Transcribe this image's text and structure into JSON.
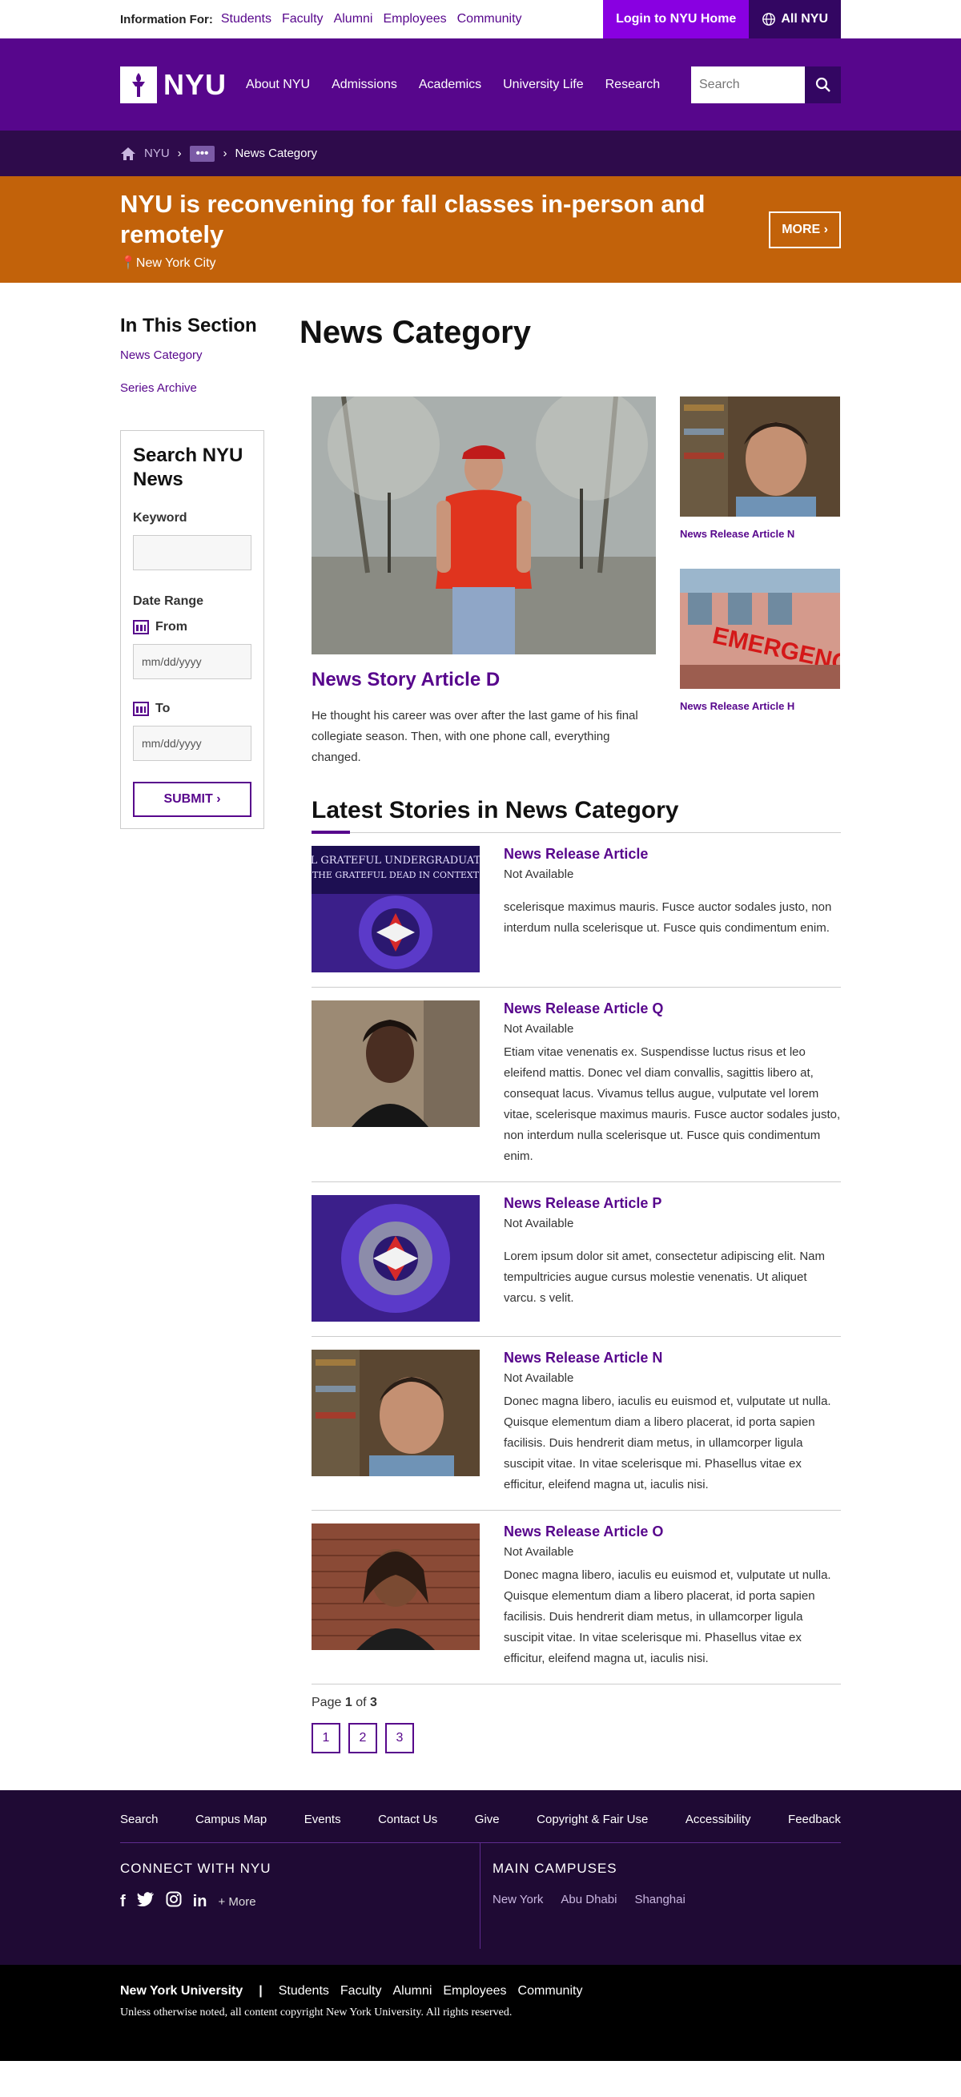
{
  "utility": {
    "label": "Information For:",
    "links": [
      "Students",
      "Faculty",
      "Alumni",
      "Employees",
      "Community"
    ],
    "login": "Login to NYU Home",
    "all_nyu": "All NYU"
  },
  "header": {
    "logo": "NYU",
    "nav": [
      "About NYU",
      "Admissions",
      "Academics",
      "University Life",
      "Research"
    ],
    "search_placeholder": "Search"
  },
  "breadcrumb": {
    "home": "NYU",
    "more": "•••",
    "current": "News Category"
  },
  "alert": {
    "title": "NYU is reconvening for fall classes in-person and remotely",
    "location": "New York City",
    "more": "MORE"
  },
  "sidebar": {
    "title": "In This Section",
    "links": [
      "News Category",
      "Series Archive"
    ],
    "search": {
      "title": "Search NYU News",
      "keyword_label": "Keyword",
      "date_range_label": "Date Range",
      "from_label": "From",
      "from_placeholder": "mm/dd/yyyy",
      "to_label": "To",
      "to_placeholder": "mm/dd/yyyy",
      "submit": "SUBMIT"
    }
  },
  "main": {
    "title": "News Category",
    "featured": {
      "title": "News Story Article D",
      "desc": "He thought his career was over after the last game of his final collegiate season. Then, with one phone call, everything changed."
    },
    "side_cards": [
      {
        "title": "News Release Article N"
      },
      {
        "title": "News Release Article H"
      }
    ],
    "latest_title": "Latest Stories in News Category",
    "stories": [
      {
        "title": "News Release Article",
        "sub": "Not Available",
        "text": "scelerisque maximus mauris. Fusce auctor sodales justo, non interdum nulla scelerisque ut. Fusce quis condimentum enim."
      },
      {
        "title": "News Release Article Q",
        "sub": "Not Available",
        "text": "Etiam vitae venenatis ex. Suspendisse luctus risus et leo eleifend mattis. Donec vel diam convallis, sagittis libero at, consequat lacus. Vivamus tellus augue, vulputate vel lorem vitae, scelerisque maximus mauris. Fusce auctor sodales justo, non interdum nulla scelerisque ut. Fusce quis condimentum enim."
      },
      {
        "title": "News Release Article P",
        "sub": "Not Available",
        "text": "Lorem ipsum dolor sit amet, consectetur adipiscing elit. Nam tempultricies augue cursus molestie venenatis. Ut aliquet varcu. s velit."
      },
      {
        "title": "News Release Article N",
        "sub": "Not Available",
        "text": "Donec magna libero, iaculis eu euismod et, vulputate ut nulla. Quisque elementum diam a libero placerat, id porta sapien facilisis. Duis hendrerit diam metus, in ullamcorper ligula suscipit vitae. In vitae scelerisque mi. Phasellus vitae ex efficitur, eleifend magna ut, iaculis nisi."
      },
      {
        "title": "News Release Article O",
        "sub": "Not Available",
        "text": "Donec magna libero, iaculis eu euismod et, vulputate ut nulla. Quisque elementum diam a libero placerat, id porta sapien facilisis. Duis hendrerit diam metus, in ullamcorper ligula suscipit vitae. In vitae scelerisque mi. Phasellus vitae ex efficitur, eleifend magna ut, iaculis nisi."
      }
    ],
    "pager": {
      "prefix": "Page",
      "current": "1",
      "of": "of",
      "total": "3",
      "pages": [
        "1",
        "2",
        "3"
      ]
    }
  },
  "footer": {
    "links": [
      "Search",
      "Campus Map",
      "Events",
      "Contact Us",
      "Give",
      "Copyright & Fair Use",
      "Accessibility",
      "Feedback"
    ],
    "connect_title": "CONNECT WITH NYU",
    "social": [
      "f",
      "twitter-icon",
      "instagram-icon",
      "in"
    ],
    "social_more": "+ More",
    "campuses_title": "MAIN CAMPUSES",
    "campuses": [
      "New York",
      "Abu Dhabi",
      "Shanghai"
    ]
  },
  "bottom": {
    "brand": "New York University",
    "sep": "|",
    "links": [
      "Students",
      "Faculty",
      "Alumni",
      "Employees",
      "Community"
    ],
    "copyright": "Unless otherwise noted, all content copyright New York University. All rights reserved."
  },
  "colors": {
    "purple": "#57068c",
    "bright_purple": "#8900e1",
    "dark_purple": "#330662",
    "alert_orange": "#c2620a"
  }
}
